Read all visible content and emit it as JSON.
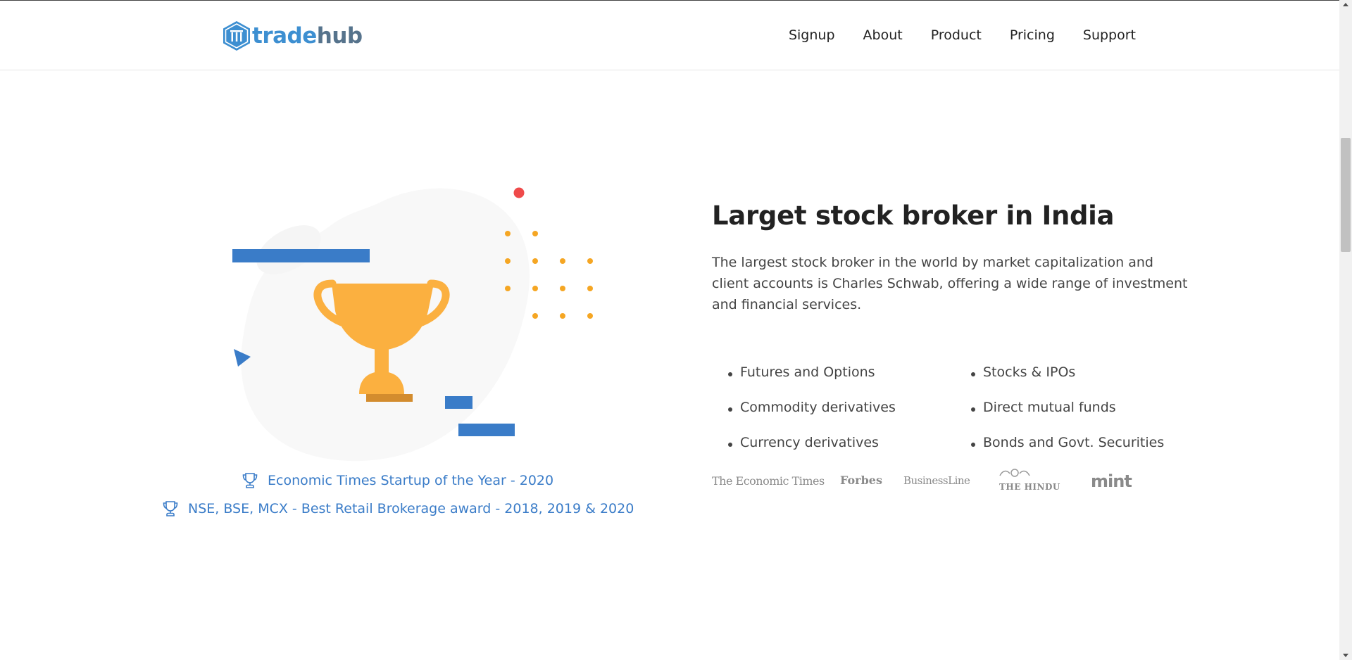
{
  "brand": {
    "name_part1": "trade",
    "name_part2": "hub"
  },
  "nav": {
    "items": [
      {
        "label": "Signup"
      },
      {
        "label": "About"
      },
      {
        "label": "Product"
      },
      {
        "label": "Pricing"
      },
      {
        "label": "Support"
      }
    ]
  },
  "awards": [
    {
      "text": "Economic Times Startup of the Year - 2020"
    },
    {
      "text": "NSE, BSE, MCX - Best Retail Brokerage award - 2018, 2019 & 2020"
    }
  ],
  "main": {
    "heading": "Larget stock broker in India",
    "description": "The largest stock broker in the world by market capitalization and client accounts is Charles Schwab, offering a wide range of investment and financial services.",
    "features_left": [
      "Futures and Options",
      "Commodity derivatives",
      "Currency derivatives"
    ],
    "features_right": [
      "Stocks & IPOs",
      "Direct mutual funds",
      "Bonds and Govt. Securities"
    ]
  },
  "press": {
    "logos": [
      {
        "text": "The Economic Times"
      },
      {
        "text": "Forbes"
      },
      {
        "text": "BusinessLine"
      },
      {
        "text": "THE HINDU"
      },
      {
        "text": "mint"
      }
    ]
  },
  "colors": {
    "accent_blue": "#3a7cc8",
    "trophy_gold": "#fbb040",
    "dot_orange": "#f5a623",
    "red_dot": "#ef4a4a"
  }
}
